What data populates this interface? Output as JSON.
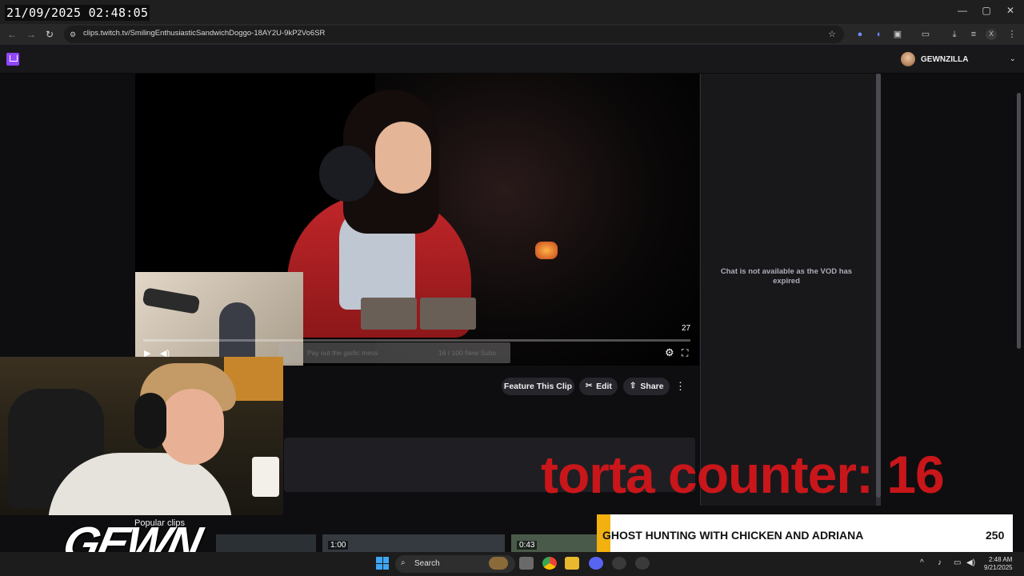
{
  "overlay": {
    "timestamp": "21/09/2025 02:48:05"
  },
  "browser": {
    "url": "clips.twitch.tv/SmilingEnthusiasticSandwichDoggo-18AY2U-9kP2Vo6SR",
    "window_controls": [
      "—",
      "▢",
      "✕"
    ],
    "icons": [
      "back-icon",
      "forward-icon",
      "reload-icon",
      "site-info-icon",
      "star-icon",
      "extension-icon",
      "download-icon",
      "menu-icon"
    ]
  },
  "twitch": {
    "username": "GEWNZILLA"
  },
  "player": {
    "counter": "27",
    "goal_text": "Pay out the garlic mess",
    "goal_count": "16 / 100 New Subs"
  },
  "actions": {
    "feature": "Feature This Clip",
    "edit": "Edit",
    "share": "Share"
  },
  "chat": {
    "message": "Chat is not available as the VOD has expired"
  },
  "stream_overlay": {
    "torta_counter": "torta counter: 16",
    "popular_clips": "Popular clips",
    "clip_times": [
      "1:00",
      "0:43"
    ],
    "logo": "GEWN"
  },
  "banner": {
    "title": "GHOST HUNTING WITH CHICKEN AND ADRIANA",
    "number": "250"
  },
  "taskbar": {
    "search": "Search",
    "time": "2:48 AM",
    "date": "9/21/2025"
  },
  "colors": {
    "twitch_purple": "#9146ff",
    "torta_red": "#c8161a",
    "banner_accent": "#f2b10e"
  }
}
